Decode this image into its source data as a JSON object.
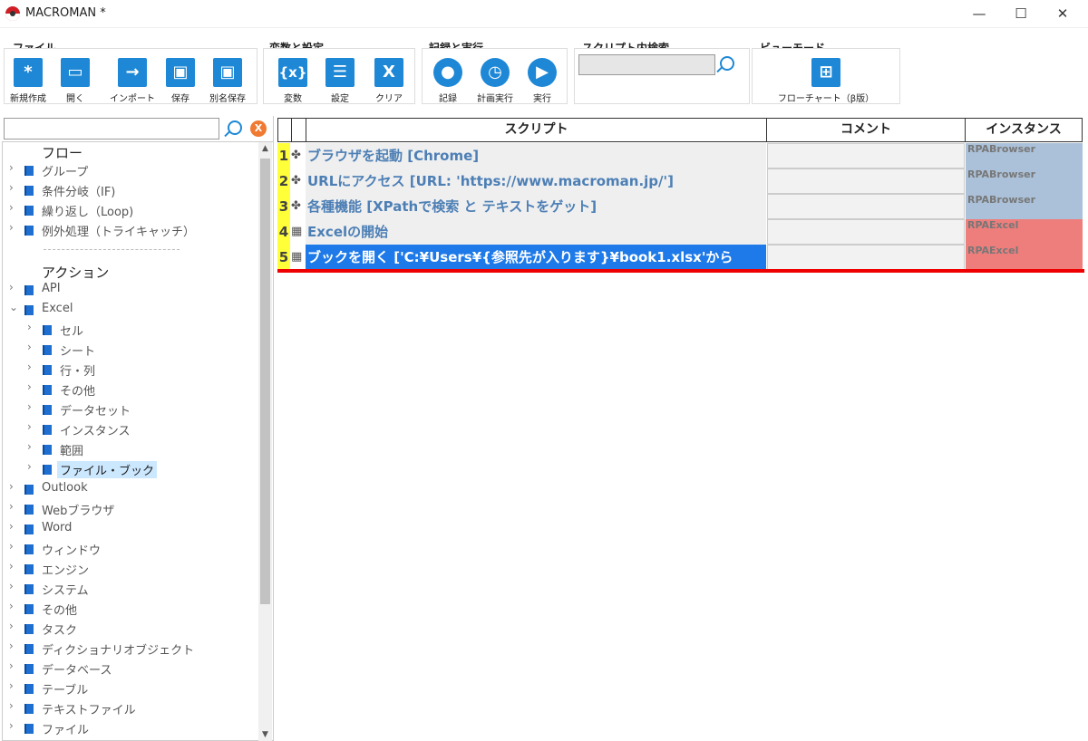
{
  "window": {
    "title": "MACROMAN *",
    "minimize": "—",
    "maximize": "☐",
    "close": "✕"
  },
  "ribbon": {
    "file_group": {
      "label": "ファイル",
      "buttons": [
        {
          "label": "新規作成",
          "glyph": "*"
        },
        {
          "label": "開く",
          "glyph": "▭"
        },
        {
          "label": "インポート",
          "glyph": "→"
        },
        {
          "label": "保存",
          "glyph": "▣"
        },
        {
          "label": "別名保存",
          "glyph": "▣"
        }
      ]
    },
    "var_group": {
      "label": "変数と設定",
      "buttons": [
        {
          "label": "変数",
          "glyph": "{x}"
        },
        {
          "label": "設定",
          "glyph": "☰"
        },
        {
          "label": "クリア",
          "glyph": "X"
        }
      ]
    },
    "run_group": {
      "label": "記録と実行",
      "buttons": [
        {
          "label": "記録",
          "glyph": "●"
        },
        {
          "label": "計画実行",
          "glyph": "◷"
        },
        {
          "label": "実行",
          "glyph": "▶"
        }
      ]
    },
    "search_group": {
      "label": "スクリプト内検索",
      "value": ""
    },
    "view_group": {
      "label": "ビューモード",
      "buttons": [
        {
          "label": "フローチャート（β版）",
          "glyph": "⊞"
        }
      ]
    }
  },
  "tree": {
    "search_value": "",
    "clear_label": "X",
    "flow_heading": "フロー",
    "flow_items": [
      "グループ",
      "条件分岐（IF)",
      "繰り返し（Loop)",
      "例外処理（トライキャッチ）"
    ],
    "action_heading": "アクション",
    "action_items": [
      {
        "label": "API",
        "level": 0,
        "expanded": false
      },
      {
        "label": "Excel",
        "level": 0,
        "expanded": true
      },
      {
        "label": "セル",
        "level": 1,
        "expanded": false
      },
      {
        "label": "シート",
        "level": 1,
        "expanded": false
      },
      {
        "label": "行・列",
        "level": 1,
        "expanded": false
      },
      {
        "label": "その他",
        "level": 1,
        "expanded": false
      },
      {
        "label": "データセット",
        "level": 1,
        "expanded": false
      },
      {
        "label": "インスタンス",
        "level": 1,
        "expanded": false
      },
      {
        "label": "範囲",
        "level": 1,
        "expanded": false
      },
      {
        "label": "ファイル・ブック",
        "level": 1,
        "expanded": false,
        "selected": true
      },
      {
        "label": "Outlook",
        "level": 0,
        "expanded": false
      },
      {
        "label": "Webブラウザ",
        "level": 0,
        "expanded": false
      },
      {
        "label": "Word",
        "level": 0,
        "expanded": false
      },
      {
        "label": "ウィンドウ",
        "level": 0,
        "expanded": false
      },
      {
        "label": "エンジン",
        "level": 0,
        "expanded": false
      },
      {
        "label": "システム",
        "level": 0,
        "expanded": false
      },
      {
        "label": "その他",
        "level": 0,
        "expanded": false
      },
      {
        "label": "タスク",
        "level": 0,
        "expanded": false
      },
      {
        "label": "ディクショナリオブジェクト",
        "level": 0,
        "expanded": false
      },
      {
        "label": "データベース",
        "level": 0,
        "expanded": false
      },
      {
        "label": "テーブル",
        "level": 0,
        "expanded": false
      },
      {
        "label": "テキストファイル",
        "level": 0,
        "expanded": false
      },
      {
        "label": "ファイル",
        "level": 0,
        "expanded": false
      }
    ]
  },
  "grid": {
    "headers": {
      "script": "スクリプト",
      "comment": "コメント",
      "instance": "インスタンス"
    },
    "rows": [
      {
        "num": "1",
        "icon": "browser-icon",
        "script": "ブラウザを起動 [Chrome]",
        "comment": "",
        "instance": "RPABrowser",
        "kind": "browser"
      },
      {
        "num": "2",
        "icon": "browser-icon",
        "script": "URLにアクセス [URL: 'https://www.macroman.jp/']",
        "comment": "",
        "instance": "RPABrowser",
        "kind": "browser"
      },
      {
        "num": "3",
        "icon": "browser-icon",
        "script": "各種機能 [XPathで検索 と テキストをゲット]",
        "comment": "",
        "instance": "RPABrowser",
        "kind": "browser"
      },
      {
        "num": "4",
        "icon": "excel-icon",
        "script": "Excelの開始",
        "comment": "",
        "instance": "RPAExcel",
        "kind": "excel"
      },
      {
        "num": "5",
        "icon": "excel-icon",
        "script": "ブックを開く ['C:¥Users¥{参照先が入ります}¥book1.xlsx'から",
        "comment": "",
        "instance": "RPAExcel",
        "kind": "excel",
        "selected": true
      }
    ]
  },
  "colors": {
    "accent": "#1e88d6",
    "row_number": "#ffff3a",
    "browser_instance": "#abc1d9",
    "excel_instance": "#ee7e7c",
    "selection": "#1e7ae8",
    "insert_marker": "#ee0000"
  }
}
